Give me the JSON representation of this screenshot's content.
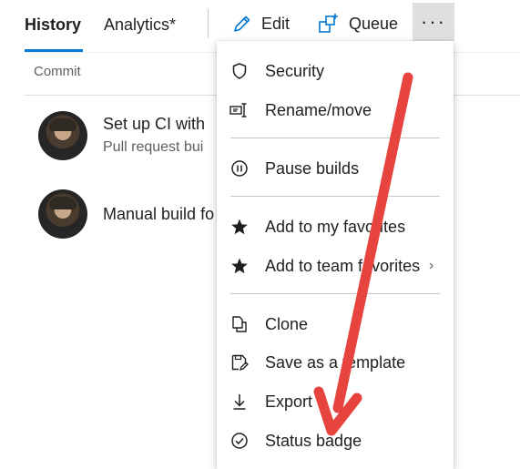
{
  "tabs": [
    {
      "label": "History",
      "active": true
    },
    {
      "label": "Analytics*",
      "active": false
    }
  ],
  "toolbar": {
    "edit_label": "Edit",
    "queue_label": "Queue",
    "more_label": "···"
  },
  "list": {
    "column_header": "Commit",
    "rows": [
      {
        "title": "Set up CI with",
        "subtitle": "Pull request bui"
      },
      {
        "title": "Manual build fo",
        "subtitle": ""
      }
    ]
  },
  "menu": {
    "items": [
      {
        "label": "Security",
        "icon": "shield-icon"
      },
      {
        "label": "Rename/move",
        "icon": "rename-icon"
      },
      {
        "label": "Pause builds",
        "icon": "pause-icon"
      },
      {
        "label": "Add to my favorites",
        "icon": "star-icon"
      },
      {
        "label": "Add to team favorites",
        "icon": "star-icon",
        "submenu": true
      },
      {
        "label": "Clone",
        "icon": "clone-icon"
      },
      {
        "label": "Save as a template",
        "icon": "save-template-icon"
      },
      {
        "label": "Export",
        "icon": "export-icon"
      },
      {
        "label": "Status badge",
        "icon": "status-badge-icon"
      }
    ],
    "submenu_chevron": "›"
  },
  "colors": {
    "accent": "#0078d4",
    "annotation_arrow": "#e8443f",
    "hover_gray": "#e1dfdd"
  }
}
